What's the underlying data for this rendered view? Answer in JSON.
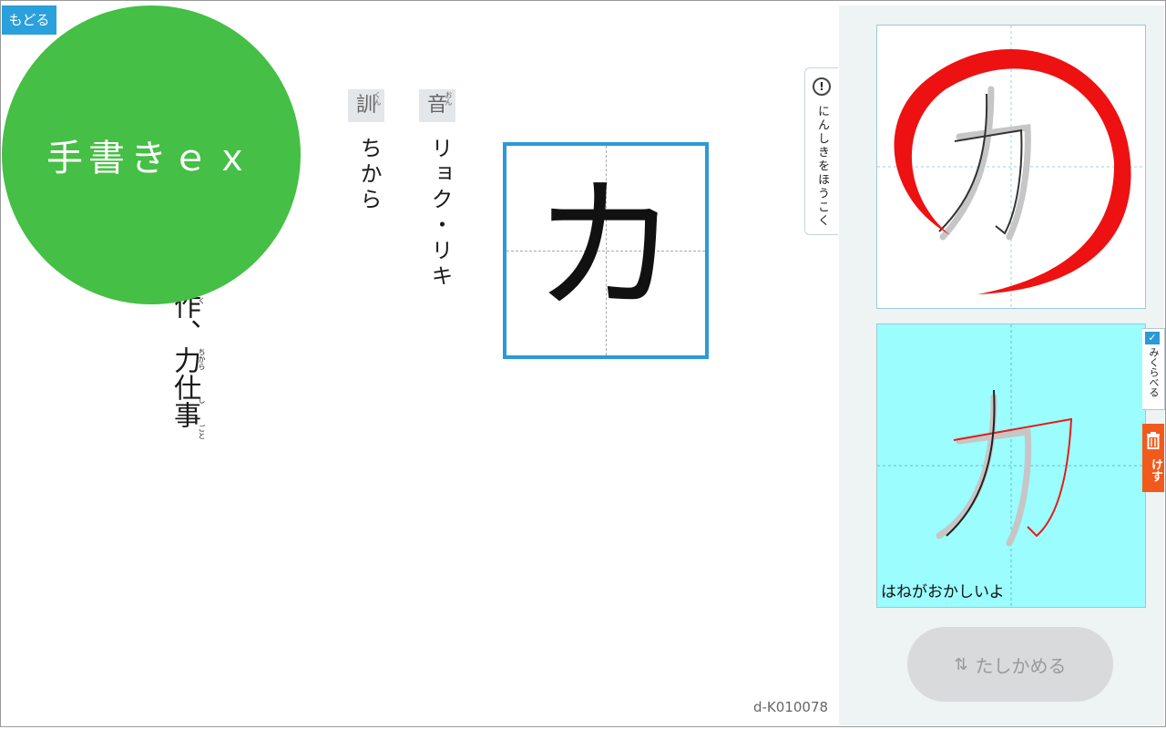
{
  "nav": {
    "back_label": "もどる"
  },
  "badge": {
    "text": "手書きｅｘ"
  },
  "readings": {
    "on": {
      "label": "音",
      "ruby": "おん",
      "text": "リョク・リキ"
    },
    "kun": {
      "label": "訓",
      "ruby": "くん",
      "text": "ちから"
    }
  },
  "examples": {
    "text": "作、力仕事",
    "ruby": [
      "く",
      "ちから",
      "し",
      "ごと"
    ]
  },
  "kanji": {
    "character": "カ"
  },
  "report": {
    "label": "にんしきをほうこく",
    "icon": "!"
  },
  "compare": {
    "label": "みくらべる"
  },
  "erase": {
    "label": "けす"
  },
  "practice": {
    "feedback": "はねがおかしいよ"
  },
  "check_button": {
    "label": "たしかめる",
    "icon": "⇅"
  },
  "code": "d-K010078",
  "colors": {
    "accent": "#2b9ad6",
    "badge": "#45bf45",
    "erase": "#f25a1d",
    "practice_bg": "#9bfdfd",
    "judgement": "#e81b1b"
  }
}
